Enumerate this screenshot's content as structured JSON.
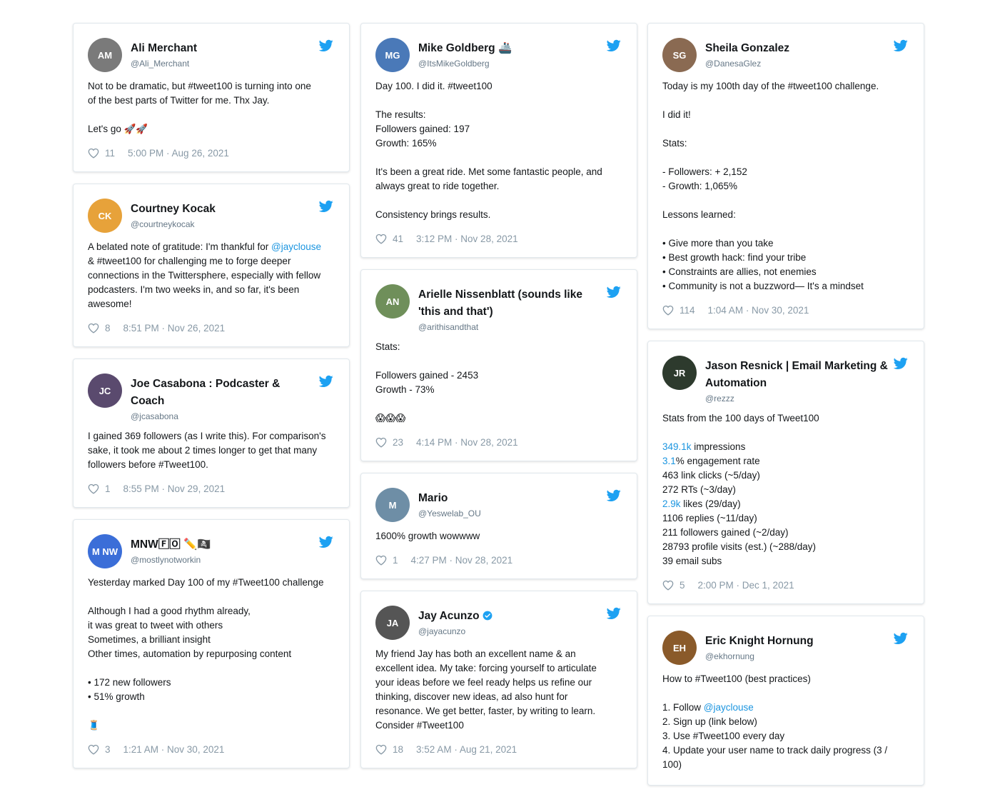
{
  "colors": {
    "twitter_blue": "#1da1f2",
    "link": "#1b95e0",
    "muted": "#8899a6",
    "border": "#e1e8ed"
  },
  "columns": [
    [
      {
        "name": "Ali Merchant",
        "handle": "@Ali_Merchant",
        "avatar": "AM",
        "avatar_color": "#7a7a7a",
        "lines": [
          "Not to be dramatic, but #tweet100 is turning into one",
          "of the best parts of Twitter for me. Thx Jay.",
          "",
          "Let's go 🚀🚀"
        ],
        "likes": "11",
        "time": "5:00 PM · Aug 26, 2021"
      },
      {
        "name": "Courtney Kocak",
        "handle": "@courtneykocak",
        "avatar": "CK",
        "avatar_color": "#e7a23a",
        "lines": [
          "A belated note of gratitude: I'm thankful for @jayclouse",
          "& #tweet100 for challenging me to forge deeper",
          "connections in the Twittersphere, especially with fellow",
          "podcasters. I'm two weeks in, and so far, it's been",
          "awesome!"
        ],
        "likes": "8",
        "time": "8:51 PM · Nov 26, 2021"
      },
      {
        "name": "Joe Casabona : Podcaster & Coach",
        "handle": "@jcasabona",
        "avatar": "JC",
        "avatar_color": "#5a4a6e",
        "lines": [
          "I gained 369 followers (as I write this). For comparison's",
          "sake, it took me about 2 times longer to get that many",
          "followers before #Tweet100."
        ],
        "likes": "1",
        "time": "8:55 PM · Nov 29, 2021"
      },
      {
        "name": "MNW🄵🄾 ✏️🏴‍☠️",
        "handle": "@mostlynotworkin",
        "avatar": "M NW",
        "avatar_color": "#3b6ed8",
        "lines": [
          "Yesterday marked Day 100 of my #Tweet100 challenge",
          "",
          "Although I had a good rhythm already,",
          "it was great to tweet with others",
          "Sometimes, a brilliant insight",
          "Other times, automation by repurposing content",
          "",
          "• 172 new followers",
          "• 51% growth",
          "",
          "🧵"
        ],
        "likes": "3",
        "time": "1:21 AM · Nov 30, 2021"
      }
    ],
    [
      {
        "name": "Mike Goldberg 🚢",
        "handle": "@ItsMikeGoldberg",
        "avatar": "MG",
        "avatar_color": "#4a79b8",
        "lines": [
          "Day 100. I did it. #tweet100",
          "",
          "The results:",
          "Followers gained: 197",
          "Growth: 165%",
          "",
          "It's been a great ride. Met some fantastic people, and",
          "always great to ride together.",
          "",
          "Consistency brings results."
        ],
        "likes": "41",
        "time": "3:12 PM · Nov 28, 2021"
      },
      {
        "name": "Arielle Nissenblatt (sounds like 'this and that')",
        "handle": "@arithisandthat",
        "avatar": "AN",
        "avatar_color": "#6f8f5a",
        "lines": [
          "Stats:",
          "",
          "Followers gained - 2453",
          "Growth - 73%",
          "",
          "😱😱😱"
        ],
        "likes": "23",
        "time": "4:14 PM · Nov 28, 2021"
      },
      {
        "name": "Mario",
        "handle": "@Yeswelab_OU",
        "avatar": "M",
        "avatar_color": "#6e8ea6",
        "lines": [
          "1600% growth wowwww"
        ],
        "likes": "1",
        "time": "4:27 PM · Nov 28, 2021"
      },
      {
        "name": "Jay Acunzo",
        "handle": "@jayacunzo",
        "avatar": "JA",
        "avatar_color": "#555555",
        "verified": true,
        "lines": [
          "My friend Jay has both an excellent name & an",
          "excellent idea. My take: forcing yourself to articulate",
          "your ideas before we feel ready helps us refine our",
          "thinking, discover new ideas, ad also hunt for",
          "resonance. We get better, faster, by writing to learn.",
          "Consider #Tweet100"
        ],
        "likes": "18",
        "time": "3:52 AM · Aug 21, 2021"
      }
    ],
    [
      {
        "name": "Sheila Gonzalez",
        "handle": "@DanesaGlez",
        "avatar": "SG",
        "avatar_color": "#8a6a52",
        "lines": [
          "Today is my 100th day of the #tweet100 challenge.",
          "",
          "I did it!",
          "",
          "Stats:",
          "",
          "- Followers: + 2,152",
          "- Growth: 1,065%",
          "",
          "Lessons learned:",
          "",
          "• Give more than you take",
          "• Best growth hack: find your tribe",
          "• Constraints are allies, not enemies",
          "• Community is not a buzzword— It's a mindset"
        ],
        "likes": "114",
        "time": "1:04 AM · Nov 30, 2021"
      },
      {
        "name": "Jason Resnick | Email Marketing & Automation",
        "handle": "@rezzz",
        "avatar": "JR",
        "avatar_color": "#2d3a2d",
        "lines": [
          "Stats from the 100 days of Tweet100",
          "",
          "349.1k impressions",
          "3.1% engagement rate",
          "463 link clicks (~5/day)",
          "272 RTs (~3/day)",
          "2.9k likes (29/day)",
          "1106 replies (~11/day)",
          "211 followers gained (~2/day)",
          "28793 profile visits (est.) (~288/day)",
          "39 email subs"
        ],
        "likes": "5",
        "time": "2:00 PM · Dec 1, 2021"
      },
      {
        "name": "Eric Knight Hornung",
        "handle": "@ekhornung",
        "avatar": "EH",
        "avatar_color": "#8a5a2a",
        "lines": [
          "How to #Tweet100 (best practices)",
          "",
          "1. Follow @jayclouse",
          "2. Sign up (link below)",
          "3. Use #Tweet100 every day",
          "4. Update your user name to track daily progress (3 /",
          "100)"
        ],
        "likes": "",
        "time": ""
      }
    ]
  ]
}
